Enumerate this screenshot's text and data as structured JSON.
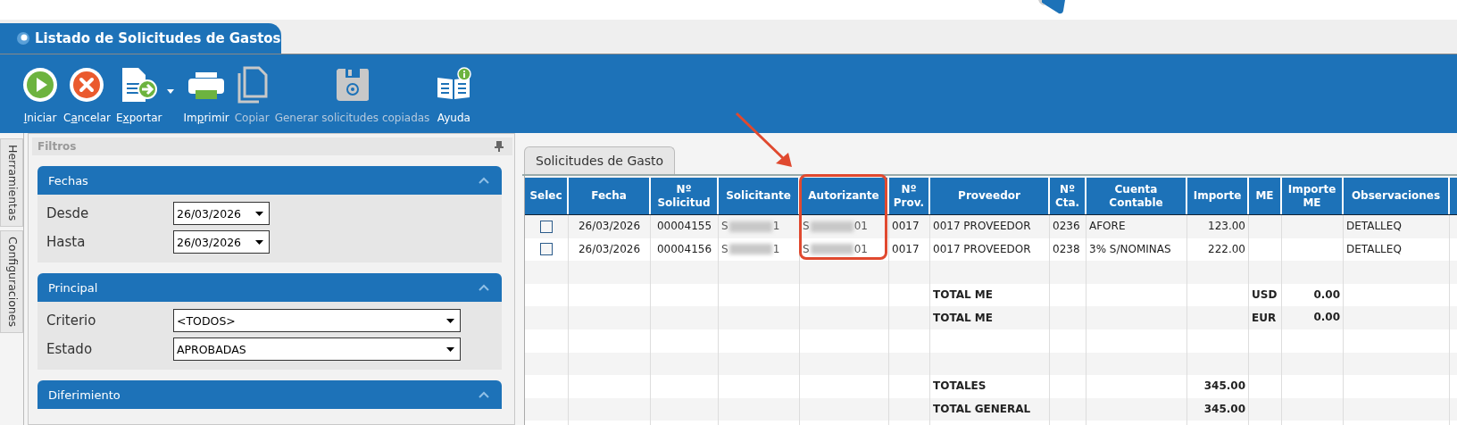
{
  "window": {
    "title": "Listado de Solicitudes de Gastos"
  },
  "toolbar": [
    {
      "key": "I",
      "post": "niciar",
      "disabled": false
    },
    {
      "pre": "C",
      "key": "a",
      "post": "ncelar",
      "disabled": false
    },
    {
      "pre": "E",
      "key": "x",
      "post": "portar",
      "disabled": false,
      "dropdown": true
    },
    {
      "pre": "Im",
      "key": "p",
      "post": "rimir",
      "disabled": false
    },
    {
      "pre": "Copiar",
      "disabled": true
    },
    {
      "pre": "Generar solicitudes copiadas",
      "disabled": true
    },
    {
      "pre": "Ayuda",
      "disabled": false
    }
  ],
  "side_tabs": [
    "Herramientas",
    "Configuraciones"
  ],
  "filters": {
    "title": "Filtros",
    "sections": [
      {
        "title": "Fechas",
        "expanded": true,
        "fields": [
          {
            "label": "Desde",
            "value": "26/03/2026",
            "kind": "date"
          },
          {
            "label": "Hasta",
            "value": "26/03/2026",
            "kind": "date"
          }
        ]
      },
      {
        "title": "Principal",
        "expanded": true,
        "fields": [
          {
            "label": "Criterio",
            "value": "<TODOS>",
            "kind": "combo"
          },
          {
            "label": "Estado",
            "value": "APROBADAS",
            "kind": "combo"
          }
        ]
      },
      {
        "title": "Diferimiento",
        "expanded": true
      }
    ]
  },
  "grid": {
    "tab": "Solicitudes de Gasto",
    "columns": [
      {
        "lines": [
          "Selec"
        ]
      },
      {
        "lines": [
          "Fecha"
        ]
      },
      {
        "lines": [
          "Nº",
          "Solicitud"
        ]
      },
      {
        "lines": [
          "Solicitante"
        ]
      },
      {
        "lines": [
          "Autorizante"
        ],
        "highlighted": true
      },
      {
        "lines": [
          "Nº",
          "Prov."
        ]
      },
      {
        "lines": [
          "Proveedor"
        ]
      },
      {
        "lines": [
          "Nº",
          "Cta."
        ]
      },
      {
        "lines": [
          "Cuenta",
          "Contable"
        ]
      },
      {
        "lines": [
          "Importe"
        ]
      },
      {
        "lines": [
          "ME"
        ]
      },
      {
        "lines": [
          "Importe",
          "ME"
        ]
      },
      {
        "lines": [
          "Observaciones"
        ]
      }
    ],
    "rows": [
      {
        "kind": "data",
        "checked": false,
        "cells": [
          null,
          "26/03/2026",
          "00004155",
          {
            "start": "S",
            "end": "1"
          },
          {
            "start": "S",
            "end": "01"
          },
          "0017",
          "0017 PROVEEDOR",
          "0236",
          "AFORE",
          "123.00",
          null,
          null,
          "DETALLEQ"
        ]
      },
      {
        "kind": "data",
        "checked": false,
        "cells": [
          null,
          "26/03/2026",
          "00004156",
          {
            "start": "S",
            "end": "1"
          },
          {
            "start": "S",
            "end": "01"
          },
          "0017",
          "0017 PROVEEDOR",
          "0238",
          "3% S/NOMINAS",
          "222.00",
          null,
          null,
          "DETALLEQ"
        ]
      },
      {
        "kind": "blank"
      },
      {
        "kind": "total",
        "cells": [
          null,
          null,
          null,
          null,
          null,
          null,
          "TOTAL ME",
          null,
          null,
          null,
          "USD",
          "0.00",
          null
        ]
      },
      {
        "kind": "total",
        "cells": [
          null,
          null,
          null,
          null,
          null,
          null,
          "TOTAL ME",
          null,
          null,
          null,
          "EUR",
          "0.00",
          null
        ]
      },
      {
        "kind": "blank"
      },
      {
        "kind": "blank"
      },
      {
        "kind": "total",
        "cells": [
          null,
          null,
          null,
          null,
          null,
          null,
          "TOTALES",
          null,
          null,
          "345.00",
          null,
          null,
          null
        ]
      },
      {
        "kind": "total",
        "cells": [
          null,
          null,
          null,
          null,
          null,
          null,
          "TOTAL GENERAL",
          null,
          null,
          "345.00",
          null,
          null,
          null
        ]
      },
      {
        "kind": "blank"
      }
    ]
  }
}
